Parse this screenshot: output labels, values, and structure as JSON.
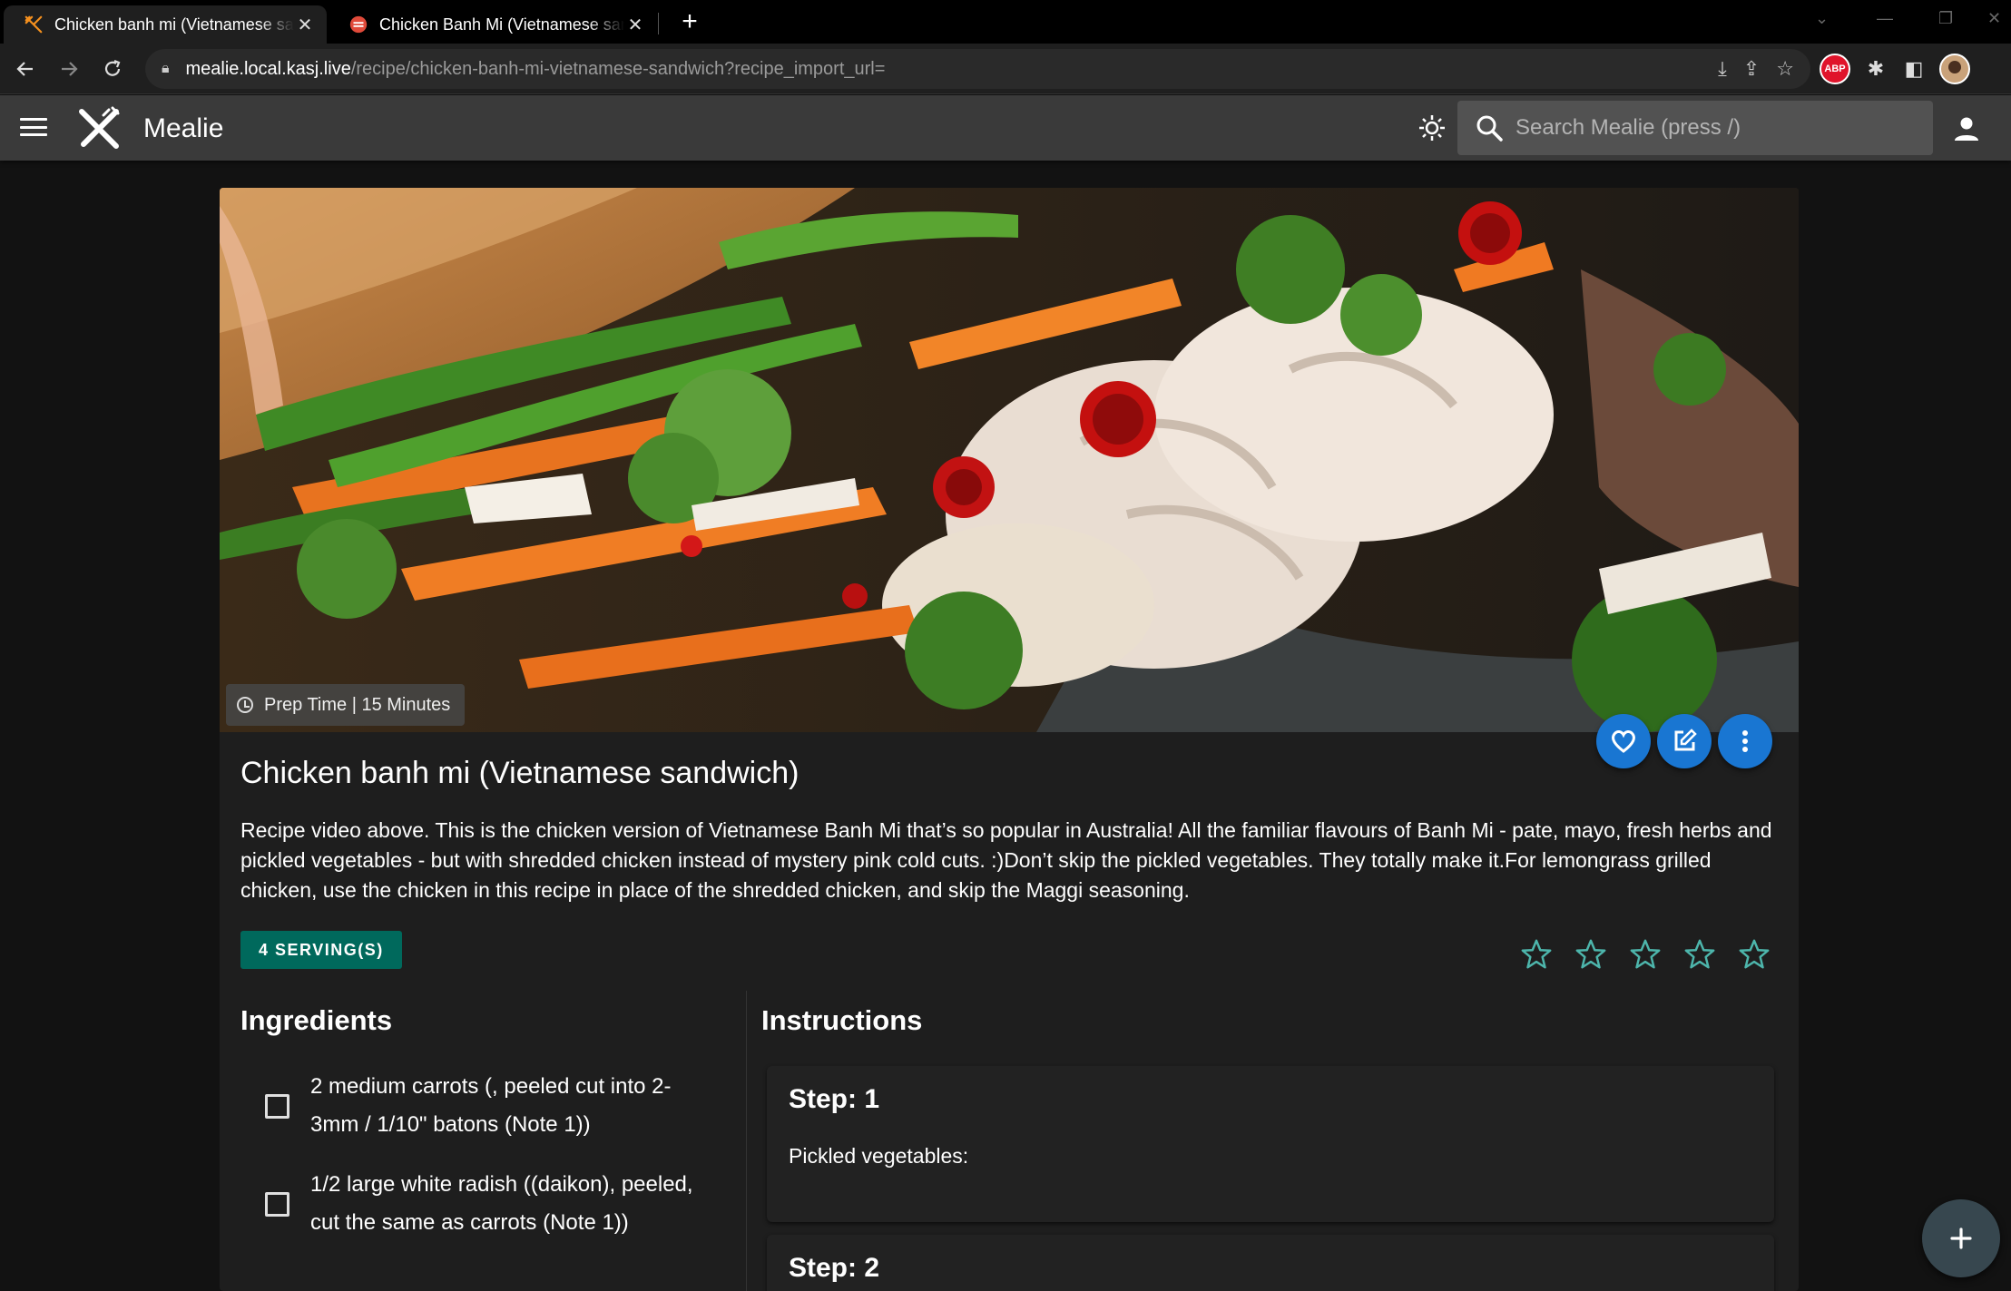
{
  "browser": {
    "tabs": [
      {
        "title": "Chicken banh mi (Vietnamese sandwich)",
        "active": true,
        "icon": "mealie-icon"
      },
      {
        "title": "Chicken Banh Mi (Vietnamese sandwich)",
        "active": false,
        "icon": "recipetin-icon"
      }
    ],
    "url_host": "mealie.local.kasj.live",
    "url_path": "/recipe/chicken-banh-mi-vietnamese-sandwich?recipe_import_url=",
    "abp_label": "ABP"
  },
  "appbar": {
    "brand": "Mealie",
    "search_placeholder": "Search Mealie (press /)"
  },
  "recipe": {
    "prep_time": "Prep Time | 15 Minutes",
    "title": "Chicken banh mi (Vietnamese sandwich)",
    "description": "Recipe video above. This is the chicken version of Vietnamese Banh Mi that’s so popular in Australia! All the familiar flavours of Banh Mi - pate, mayo, fresh herbs and pickled vegetables - but with shredded chicken instead of mystery pink cold cuts. :)Don’t skip the pickled vegetables. They totally make it.For lemongrass grilled chicken, use the chicken in this recipe in place of the shredded chicken, and skip the Maggi seasoning.",
    "servings": "4 SERVING(S)",
    "rating": 0,
    "rating_max": 5,
    "accent_color": "#1976d2",
    "servings_color": "#00695c",
    "star_color": "#4db6ac"
  },
  "ingredients": {
    "heading": "Ingredients",
    "items": [
      {
        "text": "2 medium carrots (, peeled cut into 2-3mm / 1/10\" batons (Note 1))",
        "checked": false
      },
      {
        "text": "1/2 large white radish ((daikon), peeled, cut the same as carrots (Note 1))",
        "checked": false
      }
    ]
  },
  "instructions": {
    "heading": "Instructions",
    "steps": [
      {
        "title": "Step: 1",
        "text": "Pickled vegetables:"
      },
      {
        "title": "Step: 2",
        "text": ""
      }
    ]
  }
}
